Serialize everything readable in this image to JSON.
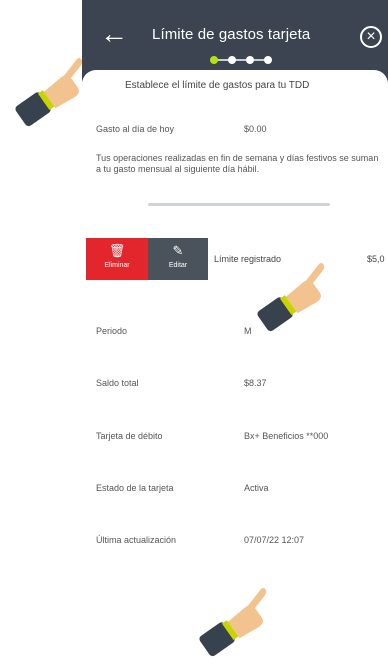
{
  "header": {
    "title": "Límite de gastos tarjeta",
    "back_icon": "arrow-left-icon",
    "close_icon": "close-circle-icon",
    "progress_steps": 4,
    "progress_active_step": 1
  },
  "subtitle": "Establece el límite de gastos para tu TDD",
  "today": {
    "label": "Gasto al día de hoy",
    "value": "$0.00"
  },
  "note": "Tus operaciones realizadas en fin de semana y días festivos se suman a tu gasto mensual al siguiente día hábil.",
  "actions": {
    "delete_label": "Eliminar",
    "edit_label": "Editar",
    "delete_icon": "trash-icon",
    "edit_icon": "pencil-icon"
  },
  "limit": {
    "label": "Límite registrado",
    "value": "$5,0"
  },
  "details": [
    {
      "label": "Periodo",
      "value": "M"
    },
    {
      "label": "Saldo total",
      "value": "$8.37"
    },
    {
      "label": "Tarjeta de débito",
      "value": "Bx+ Beneficios **000"
    },
    {
      "label": "Estado de la tarjeta",
      "value": "Activa"
    },
    {
      "label": "Última actualización",
      "value": "07/07/22 12:07"
    }
  ],
  "colors": {
    "header_bg": "#3b4450",
    "delete_bg": "#e3262c",
    "edit_bg": "#4a535c",
    "progress_active": "#b5e20e"
  },
  "overlay_icons": [
    "pointing-hand-icon",
    "pointing-hand-icon",
    "pointing-hand-icon"
  ]
}
